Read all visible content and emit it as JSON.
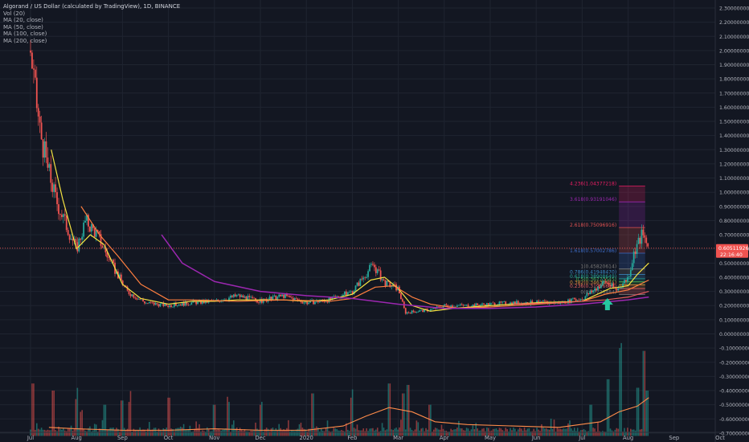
{
  "legend": {
    "title": "Algorand / US Dollar (calculated by TradingView), 1D, BINANCE",
    "items": [
      "Vol (20)",
      "MA (20, close)",
      "MA (50, close)",
      "MA (100, close)",
      "MA (200, close)"
    ]
  },
  "colors": {
    "background": "#131722",
    "grid": "#1f2430",
    "axis_text": "#b2b5be",
    "candle_up": "#26a69a",
    "candle_down": "#ef5350",
    "ma20": "#f5e342",
    "ma50": "#ff7f3f",
    "ma100": "#e85f5f",
    "ma200": "#9c27b0",
    "vol_ma": "#ff8c4a",
    "price_line": "#ef5350",
    "arrow": "#26c6a0"
  },
  "price_badges": {
    "last_price": "0.60511926",
    "countdown": "22:16:40"
  },
  "chart_data": {
    "type": "candlestick",
    "title": "Algorand / US Dollar (calculated by TradingView), 1D, BINANCE",
    "x_tick_labels": [
      "Jul",
      "Aug",
      "Sep",
      "Oct",
      "Nov",
      "Dec",
      "2020",
      "Feb",
      "Mar",
      "Apr",
      "May",
      "Jun",
      "Jul",
      "Aug",
      "Sep",
      "Oct"
    ],
    "y_tick_labels": [
      "2.30000000",
      "2.20000000",
      "2.10000000",
      "2.00000000",
      "1.90000000",
      "1.80000000",
      "1.70000000",
      "1.60000000",
      "1.50000000",
      "1.40000000",
      "1.30000000",
      "1.20000000",
      "1.10000000",
      "1.00000000",
      "0.90000000",
      "0.80000000",
      "0.70000000",
      "0.60000000",
      "0.50000000",
      "0.40000000",
      "0.30000000",
      "0.20000000",
      "0.10000000",
      "0.00000000",
      "-0.10000000",
      "-0.20000000",
      "-0.30000000",
      "-0.40000000",
      "-0.50000000",
      "-0.60000000",
      "-0.70000000"
    ],
    "ylim": [
      -0.72,
      2.35
    ],
    "price_anchors": [
      {
        "month": 0.0,
        "value": 2.0
      },
      {
        "month": 0.1,
        "value": 1.7
      },
      {
        "month": 0.2,
        "value": 1.45
      },
      {
        "month": 0.35,
        "value": 1.2
      },
      {
        "month": 0.55,
        "value": 0.95
      },
      {
        "month": 0.8,
        "value": 0.75
      },
      {
        "month": 1.0,
        "value": 0.6
      },
      {
        "month": 1.2,
        "value": 0.8
      },
      {
        "month": 1.45,
        "value": 0.7
      },
      {
        "month": 1.75,
        "value": 0.5
      },
      {
        "month": 2.1,
        "value": 0.3
      },
      {
        "month": 2.5,
        "value": 0.22
      },
      {
        "month": 3.0,
        "value": 0.2
      },
      {
        "month": 3.5,
        "value": 0.22
      },
      {
        "month": 4.0,
        "value": 0.23
      },
      {
        "month": 4.5,
        "value": 0.27
      },
      {
        "month": 5.0,
        "value": 0.23
      },
      {
        "month": 5.5,
        "value": 0.27
      },
      {
        "month": 6.0,
        "value": 0.22
      },
      {
        "month": 6.5,
        "value": 0.24
      },
      {
        "month": 7.0,
        "value": 0.3
      },
      {
        "month": 7.45,
        "value": 0.49
      },
      {
        "month": 7.7,
        "value": 0.36
      },
      {
        "month": 8.0,
        "value": 0.32
      },
      {
        "month": 8.15,
        "value": 0.15
      },
      {
        "month": 8.4,
        "value": 0.16
      },
      {
        "month": 8.7,
        "value": 0.17
      },
      {
        "month": 9.0,
        "value": 0.2
      },
      {
        "month": 9.5,
        "value": 0.2
      },
      {
        "month": 10.0,
        "value": 0.21
      },
      {
        "month": 10.5,
        "value": 0.22
      },
      {
        "month": 11.0,
        "value": 0.22
      },
      {
        "month": 11.5,
        "value": 0.22
      },
      {
        "month": 12.0,
        "value": 0.25
      },
      {
        "month": 12.5,
        "value": 0.37
      },
      {
        "month": 12.75,
        "value": 0.31
      },
      {
        "month": 13.0,
        "value": 0.4
      },
      {
        "month": 13.15,
        "value": 0.6
      },
      {
        "month": 13.3,
        "value": 0.7
      },
      {
        "month": 13.45,
        "value": 0.61
      }
    ],
    "series": [
      {
        "name": "MA (20, close)",
        "points": [
          [
            0.45,
            1.3
          ],
          [
            0.7,
            0.95
          ],
          [
            1.0,
            0.6
          ],
          [
            1.3,
            0.7
          ],
          [
            1.6,
            0.63
          ],
          [
            2.0,
            0.35
          ],
          [
            2.4,
            0.25
          ],
          [
            3.0,
            0.21
          ],
          [
            3.5,
            0.23
          ],
          [
            4.0,
            0.23
          ],
          [
            4.5,
            0.24
          ],
          [
            5.0,
            0.24
          ],
          [
            5.5,
            0.24
          ],
          [
            6.0,
            0.23
          ],
          [
            6.5,
            0.24
          ],
          [
            7.0,
            0.28
          ],
          [
            7.4,
            0.38
          ],
          [
            7.7,
            0.4
          ],
          [
            8.0,
            0.32
          ],
          [
            8.3,
            0.2
          ],
          [
            8.7,
            0.16
          ],
          [
            9.2,
            0.18
          ],
          [
            10.0,
            0.2
          ],
          [
            11.0,
            0.22
          ],
          [
            12.0,
            0.23
          ],
          [
            12.6,
            0.32
          ],
          [
            13.0,
            0.34
          ],
          [
            13.2,
            0.42
          ],
          [
            13.45,
            0.5
          ]
        ]
      },
      {
        "name": "MA (50, close)",
        "points": [
          [
            1.1,
            0.9
          ],
          [
            1.5,
            0.7
          ],
          [
            1.9,
            0.55
          ],
          [
            2.4,
            0.35
          ],
          [
            3.0,
            0.24
          ],
          [
            3.5,
            0.24
          ],
          [
            4.5,
            0.23
          ],
          [
            5.5,
            0.24
          ],
          [
            6.5,
            0.23
          ],
          [
            7.0,
            0.25
          ],
          [
            7.5,
            0.33
          ],
          [
            7.9,
            0.34
          ],
          [
            8.3,
            0.26
          ],
          [
            8.7,
            0.21
          ],
          [
            9.3,
            0.18
          ],
          [
            10.0,
            0.19
          ],
          [
            11.0,
            0.21
          ],
          [
            12.0,
            0.23
          ],
          [
            12.5,
            0.28
          ],
          [
            13.0,
            0.31
          ],
          [
            13.45,
            0.38
          ]
        ]
      },
      {
        "name": "MA (100, close)",
        "points": [
          [
            10.5,
            0.21
          ],
          [
            11.5,
            0.22
          ],
          [
            12.5,
            0.24
          ],
          [
            13.0,
            0.26
          ],
          [
            13.45,
            0.3
          ]
        ]
      },
      {
        "name": "MA (200, close)",
        "points": [
          [
            2.85,
            0.7
          ],
          [
            3.3,
            0.5
          ],
          [
            4.0,
            0.37
          ],
          [
            5.0,
            0.3
          ],
          [
            6.0,
            0.27
          ],
          [
            7.0,
            0.25
          ],
          [
            8.0,
            0.21
          ],
          [
            9.0,
            0.18
          ],
          [
            10.0,
            0.18
          ],
          [
            11.0,
            0.19
          ],
          [
            12.0,
            0.21
          ],
          [
            13.0,
            0.24
          ],
          [
            13.45,
            0.26
          ]
        ]
      }
    ],
    "volume_ma": [
      [
        0.4,
        -0.66
      ],
      [
        1.0,
        -0.67
      ],
      [
        2.0,
        -0.68
      ],
      [
        3.0,
        -0.68
      ],
      [
        4.0,
        -0.67
      ],
      [
        5.0,
        -0.68
      ],
      [
        6.0,
        -0.68
      ],
      [
        6.8,
        -0.65
      ],
      [
        7.3,
        -0.58
      ],
      [
        7.8,
        -0.52
      ],
      [
        8.3,
        -0.55
      ],
      [
        8.8,
        -0.62
      ],
      [
        9.5,
        -0.64
      ],
      [
        10.5,
        -0.65
      ],
      [
        11.5,
        -0.66
      ],
      [
        12.4,
        -0.62
      ],
      [
        12.8,
        -0.55
      ],
      [
        13.2,
        -0.51
      ],
      [
        13.45,
        -0.45
      ]
    ],
    "volume_spikes": [
      [
        0.05,
        -0.35
      ],
      [
        0.5,
        -0.4
      ],
      [
        1.0,
        -0.46
      ],
      [
        1.1,
        -0.55
      ],
      [
        1.6,
        -0.5
      ],
      [
        2.0,
        -0.47
      ],
      [
        2.15,
        -0.48
      ],
      [
        3.0,
        -0.45
      ],
      [
        4.0,
        -0.5
      ],
      [
        4.3,
        -0.48
      ],
      [
        5.0,
        -0.5
      ],
      [
        6.15,
        -0.42
      ],
      [
        7.0,
        -0.45
      ],
      [
        7.8,
        -0.35
      ],
      [
        8.1,
        -0.42
      ],
      [
        8.2,
        -0.36
      ],
      [
        8.7,
        -0.5
      ],
      [
        12.2,
        -0.5
      ],
      [
        12.55,
        -0.32
      ],
      [
        12.85,
        -0.1
      ],
      [
        13.2,
        -0.38
      ],
      [
        13.35,
        -0.12
      ],
      [
        13.42,
        -0.4
      ]
    ],
    "fibonacci": {
      "range": [
        12.8,
        13.37
      ],
      "levels": [
        {
          "ratio": "0",
          "label": "0(0.27726484)",
          "value": 0.2773
        },
        {
          "ratio": "0.236",
          "label": "0.236(0.31996698)",
          "value": 0.32
        },
        {
          "ratio": "0.382",
          "label": "0.382(0.34638441)",
          "value": 0.3464
        },
        {
          "ratio": "0.5",
          "label": "0.5(0.36773545)",
          "value": 0.3677
        },
        {
          "ratio": "0.618",
          "label": "0.618(0.38908649)",
          "value": 0.3891
        },
        {
          "ratio": "0.786",
          "label": "0.786(0.41948470)",
          "value": 0.4195
        },
        {
          "ratio": "1",
          "label": "1(0.45820614)",
          "value": 0.4582
        },
        {
          "ratio": "1.618",
          "label": "1.618(0.57002786)",
          "value": 0.57
        },
        {
          "ratio": "2.618",
          "label": "2.618(0.75096916)",
          "value": 0.751
        },
        {
          "ratio": "3.618",
          "label": "3.618(0.93191046)",
          "value": 0.9319
        },
        {
          "ratio": "4.236",
          "label": "4.236(1.04377218)",
          "value": 1.0438
        }
      ]
    },
    "annotations": [
      {
        "type": "up-arrow",
        "month": 12.55,
        "value": 0.19
      }
    ]
  }
}
